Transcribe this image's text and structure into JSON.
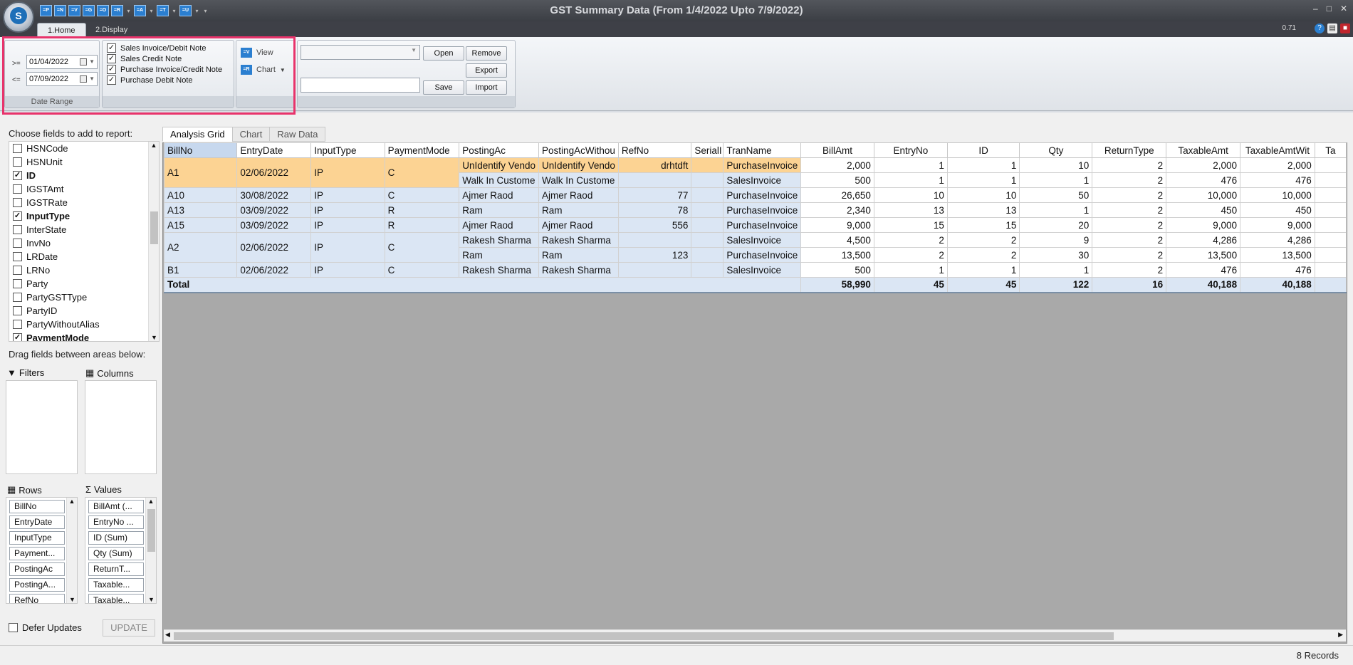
{
  "window": {
    "title": "GST Summary Data (From 1/4/2022 Upto 7/9/2022)",
    "orb_letter": "S",
    "version": "0.71"
  },
  "qat": [
    "=P",
    "=N",
    "=V",
    "=G",
    "=O",
    "=R",
    "=A",
    "=T",
    "=U"
  ],
  "tabs": [
    {
      "label": "1.Home"
    },
    {
      "label": "2.Display"
    }
  ],
  "ribbon": {
    "date_range": {
      "caption": "Date Range",
      "from_op": ">=",
      "from": "01/04/2022",
      "to_op": "<=",
      "to": "07/09/2022"
    },
    "filters": [
      {
        "label": "Sales Invoice/Debit Note",
        "checked": true
      },
      {
        "label": "Sales Credit Note",
        "checked": true
      },
      {
        "label": "Purchase Invoice/Credit Note",
        "checked": true
      },
      {
        "label": "Purchase Debit Note",
        "checked": true
      }
    ],
    "view_label": "View",
    "chart_label": "Chart",
    "open_label": "Open",
    "remove_label": "Remove",
    "export_label": "Export",
    "save_label": "Save",
    "import_label": "Import"
  },
  "field_list": {
    "title": "Choose fields to add to report:",
    "items": [
      {
        "label": "HSNCode",
        "checked": false
      },
      {
        "label": "HSNUnit",
        "checked": false
      },
      {
        "label": "ID",
        "checked": true
      },
      {
        "label": "IGSTAmt",
        "checked": false
      },
      {
        "label": "IGSTRate",
        "checked": false
      },
      {
        "label": "InputType",
        "checked": true
      },
      {
        "label": "InterState",
        "checked": false
      },
      {
        "label": "InvNo",
        "checked": false
      },
      {
        "label": "LRDate",
        "checked": false
      },
      {
        "label": "LRNo",
        "checked": false
      },
      {
        "label": "Party",
        "checked": false
      },
      {
        "label": "PartyGSTType",
        "checked": false
      },
      {
        "label": "PartyID",
        "checked": false
      },
      {
        "label": "PartyWithoutAlias",
        "checked": false
      },
      {
        "label": "PaymentMode",
        "checked": true
      }
    ],
    "drag_hint": "Drag fields between areas below:",
    "filters_label": "Filters",
    "columns_label": "Columns",
    "rows_label": "Rows",
    "values_label": "Values",
    "rows": [
      "BillNo",
      "EntryDate",
      "InputType",
      "Payment...",
      "PostingAc",
      "PostingA...",
      "RefNo"
    ],
    "values": [
      "BillAmt (...",
      "EntryNo ...",
      "ID (Sum)",
      "Qty (Sum)",
      "ReturnT...",
      "Taxable...",
      "Taxable..."
    ],
    "defer_label": "Defer Updates",
    "update_label": "UPDATE"
  },
  "grid_tabs": [
    {
      "label": "Analysis Grid"
    },
    {
      "label": "Chart"
    },
    {
      "label": "Raw Data"
    }
  ],
  "grid": {
    "columns": [
      "BillNo",
      "EntryDate",
      "InputType",
      "PaymentMode",
      "PostingAc",
      "PostingAcWithou",
      "RefNo",
      "SerialI",
      "TranName",
      "BillAmt",
      "EntryNo",
      "ID",
      "Qty",
      "ReturnType",
      "TaxableAmt",
      "TaxableAmtWit",
      "Ta"
    ],
    "groups": [
      {
        "bill": "A1",
        "date": "02/06/2022",
        "input": "IP",
        "pay": "C",
        "highlight": true,
        "rows": [
          {
            "posting": "UnIdentify Vendo",
            "postingw": "UnIdentify Vendo",
            "ref": "drhtdft",
            "serial": "",
            "tran": "PurchaseInvoice",
            "billamt": "2,000",
            "entry": "1",
            "id": "1",
            "qty": "10",
            "ret": "2",
            "tax": "2,000",
            "taxw": "2,000"
          },
          {
            "posting": "Walk In Custome",
            "postingw": "Walk In Custome",
            "ref": "",
            "serial": "",
            "tran": "SalesInvoice",
            "billamt": "500",
            "entry": "1",
            "id": "1",
            "qty": "1",
            "ret": "2",
            "tax": "476",
            "taxw": "476"
          }
        ]
      },
      {
        "bill": "A10",
        "date": "30/08/2022",
        "input": "IP",
        "pay": "C",
        "highlight": false,
        "rows": [
          {
            "posting": "Ajmer Raod",
            "postingw": "Ajmer Raod",
            "ref": "77",
            "serial": "",
            "tran": "PurchaseInvoice",
            "billamt": "26,650",
            "entry": "10",
            "id": "10",
            "qty": "50",
            "ret": "2",
            "tax": "10,000",
            "taxw": "10,000"
          }
        ]
      },
      {
        "bill": "A13",
        "date": "03/09/2022",
        "input": "IP",
        "pay": "R",
        "highlight": false,
        "rows": [
          {
            "posting": "Ram",
            "postingw": "Ram",
            "ref": "78",
            "serial": "",
            "tran": "PurchaseInvoice",
            "billamt": "2,340",
            "entry": "13",
            "id": "13",
            "qty": "1",
            "ret": "2",
            "tax": "450",
            "taxw": "450"
          }
        ]
      },
      {
        "bill": "A15",
        "date": "03/09/2022",
        "input": "IP",
        "pay": "R",
        "highlight": false,
        "rows": [
          {
            "posting": "Ajmer Raod",
            "postingw": "Ajmer Raod",
            "ref": "556",
            "serial": "",
            "tran": "PurchaseInvoice",
            "billamt": "9,000",
            "entry": "15",
            "id": "15",
            "qty": "20",
            "ret": "2",
            "tax": "9,000",
            "taxw": "9,000"
          }
        ]
      },
      {
        "bill": "A2",
        "date": "02/06/2022",
        "input": "IP",
        "pay": "C",
        "highlight": false,
        "rows": [
          {
            "posting": "Rakesh Sharma",
            "postingw": "Rakesh Sharma",
            "ref": "",
            "serial": "",
            "tran": "SalesInvoice",
            "billamt": "4,500",
            "entry": "2",
            "id": "2",
            "qty": "9",
            "ret": "2",
            "tax": "4,286",
            "taxw": "4,286"
          },
          {
            "posting": "Ram",
            "postingw": "Ram",
            "ref": "123",
            "serial": "",
            "tran": "PurchaseInvoice",
            "billamt": "13,500",
            "entry": "2",
            "id": "2",
            "qty": "30",
            "ret": "2",
            "tax": "13,500",
            "taxw": "13,500"
          }
        ]
      },
      {
        "bill": "B1",
        "date": "02/06/2022",
        "input": "IP",
        "pay": "C",
        "highlight": false,
        "rows": [
          {
            "posting": "Rakesh Sharma",
            "postingw": "Rakesh Sharma",
            "ref": "",
            "serial": "",
            "tran": "SalesInvoice",
            "billamt": "500",
            "entry": "1",
            "id": "1",
            "qty": "1",
            "ret": "2",
            "tax": "476",
            "taxw": "476"
          }
        ]
      }
    ],
    "total": {
      "label": "Total",
      "billamt": "58,990",
      "entry": "45",
      "id": "45",
      "qty": "122",
      "ret": "16",
      "tax": "40,188",
      "taxw": "40,188"
    }
  },
  "status": {
    "records": "8 Records"
  }
}
